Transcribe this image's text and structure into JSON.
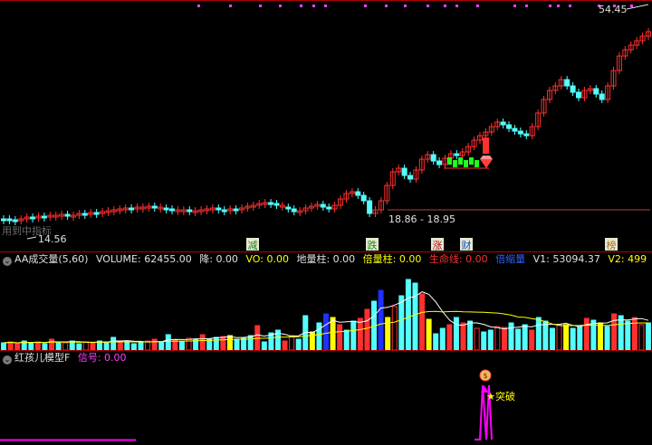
{
  "price_chart": {
    "high_label": "54.45",
    "low_label": "14.56",
    "range_label": "18.86 - 18.95",
    "watermark": "用到中指标",
    "markers": [
      {
        "text": "减",
        "color": "#1a8a1a"
      },
      {
        "text": "跌",
        "color": "#1a8a1a"
      },
      {
        "text": "涨",
        "color": "#b01010"
      },
      {
        "text": "财",
        "color": "#1050c0"
      },
      {
        "text": "榜",
        "color": "#b07010"
      }
    ]
  },
  "volume_header": {
    "title": "AA成交量(5,60)",
    "items": [
      {
        "label": "VOLUME:",
        "value": "62455.00",
        "color": "#e0e0e0"
      },
      {
        "label": "降:",
        "value": "0.00",
        "color": "#e0e0e0"
      },
      {
        "label": "VO:",
        "value": "0.00",
        "color": "#ffff00"
      },
      {
        "label": "地量柱:",
        "value": "0.00",
        "color": "#e0e0e0"
      },
      {
        "label": "倍量柱:",
        "value": "0.00",
        "color": "#ffff00"
      },
      {
        "label": "生命线:",
        "value": "0.00",
        "color": "#ff3030"
      },
      {
        "label": "倍缩量",
        "value": "",
        "color": "#3060ff"
      },
      {
        "label": "V1:",
        "value": "53094.37",
        "color": "#e0e0e0"
      },
      {
        "label": "V2:",
        "value": "499",
        "color": "#ffff00"
      }
    ]
  },
  "signal_header": {
    "title": "红孩儿模型F",
    "items": [
      {
        "label": "信号:",
        "value": "0.00",
        "color": "#ff40ff"
      }
    ]
  },
  "signal_chart": {
    "breakout_label": "突破",
    "badge_glyph": "$"
  },
  "colors": {
    "up": "#ff3030",
    "down": "#54ffff",
    "grid": "#b20000",
    "magenta": "#ff00ff",
    "yellow": "#ffff00"
  }
}
